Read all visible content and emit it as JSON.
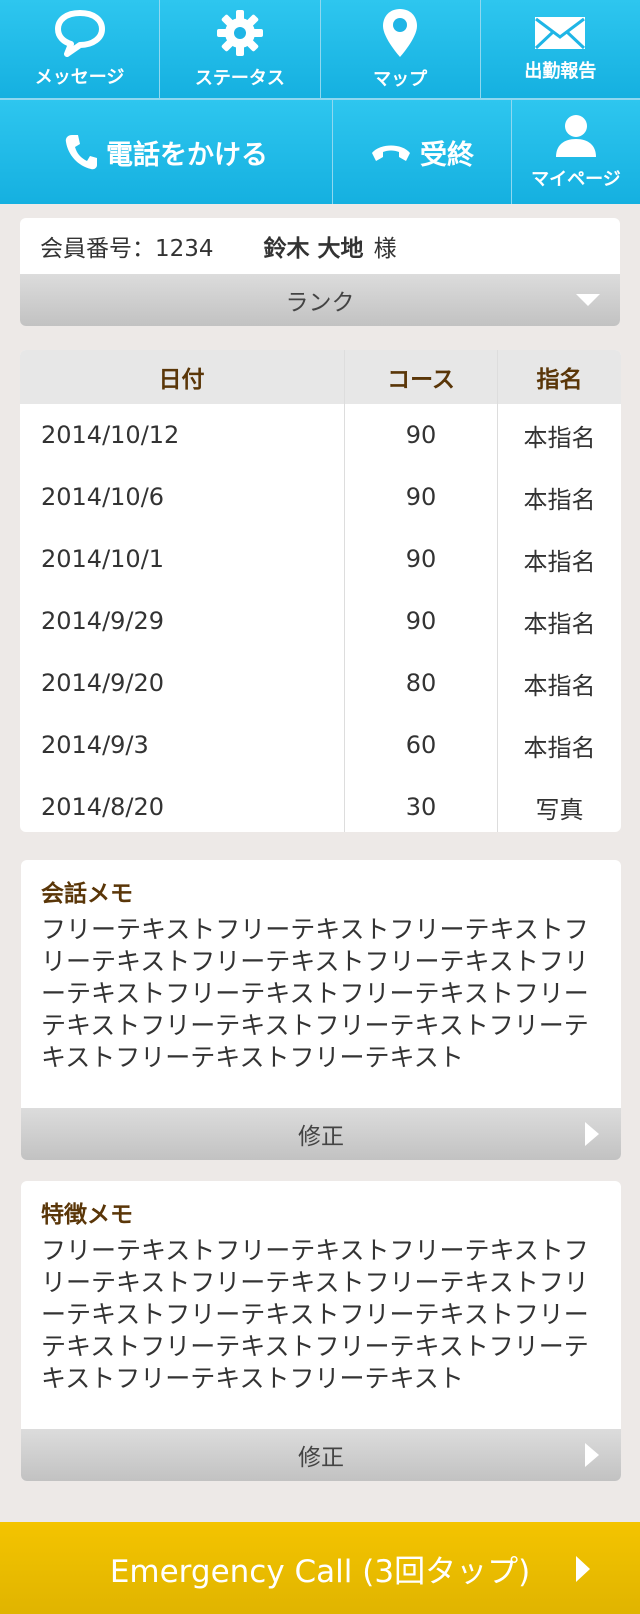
{
  "nav": {
    "message": "メッセージ",
    "status": "ステータス",
    "map": "マップ",
    "report": "出勤報告",
    "call": "電話をかける",
    "hangup": "受終",
    "mypage": "マイページ"
  },
  "member": {
    "number_label": "会員番号：1234",
    "name": "鈴木 大地",
    "honorific": "様",
    "rank": "ランク"
  },
  "history": {
    "headers": [
      "日付",
      "コース",
      "指名"
    ],
    "rows": [
      [
        "2014/10/12",
        "90",
        "本指名"
      ],
      [
        "2014/10/6",
        "90",
        "本指名"
      ],
      [
        "2014/10/1",
        "90",
        "本指名"
      ],
      [
        "2014/9/29",
        "90",
        "本指名"
      ],
      [
        "2014/9/20",
        "80",
        "本指名"
      ],
      [
        "2014/9/3",
        "60",
        "本指名"
      ],
      [
        "2014/8/20",
        "30",
        "写真"
      ]
    ]
  },
  "conversation_memo": {
    "title": "会話メモ",
    "text": "フリーテキストフリーテキストフリーテキストフリーテキストフリーテキストフリーテキストフリーテキストフリーテキストフリーテキストフリーテキストフリーテキストフリーテキストフリーテキストフリーテキストフリーテキスト",
    "edit_label": "修正"
  },
  "feature_memo": {
    "title": "特徴メモ",
    "text": "フリーテキストフリーテキストフリーテキストフリーテキストフリーテキストフリーテキストフリーテキストフリーテキストフリーテキストフリーテキストフリーテキストフリーテキストフリーテキストフリーテキストフリーテキスト",
    "edit_label": "修正"
  },
  "emergency": {
    "label": "Emergency Call (3回タップ)"
  },
  "colors": {
    "nav": "#1ab8e8",
    "emergency": "#f0c000",
    "heading": "#5a3608",
    "background": "#ede9e7"
  }
}
